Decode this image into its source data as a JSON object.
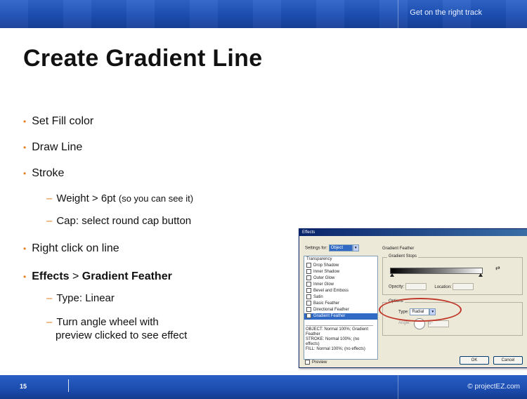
{
  "header": {
    "tagline": "Get on the right track"
  },
  "title": "Create Gradient Line",
  "bullets": [
    {
      "text": "Set Fill color"
    },
    {
      "text": "Draw Line"
    },
    {
      "text": "Stroke"
    },
    {
      "sub_prefix": "Weight > 6pt ",
      "sub_note": "(so you can see it)"
    },
    {
      "text": "Cap:  select round cap button"
    },
    {
      "text": "Right click on line"
    },
    {
      "bold1": "Effects",
      "sep": " > ",
      "bold2": "Gradient Feather"
    },
    {
      "text": "Type:  Linear"
    },
    {
      "text": "Turn angle wheel with"
    },
    {
      "text": "preview clicked to see effect"
    }
  ],
  "footer": {
    "slide_number": "15",
    "copyright": "© projectEZ.com"
  },
  "dialog": {
    "title": "Effects",
    "settings_label": "Settings for:",
    "settings_value": "Object",
    "list_items": [
      "Transparency",
      "Drop Shadow",
      "Inner Shadow",
      "Outer Glow",
      "Inner Glow",
      "Bevel and Emboss",
      "Satin",
      "Basic Feather",
      "Directional Feather",
      "Gradient Feather"
    ],
    "summary": [
      "OBJECT: Normal 100%; Gradient Feather",
      "STROKE: Normal 100%; (no effects)",
      "FILL: Normal 100%; (no effects)"
    ],
    "preview_label": "Preview",
    "panel_title": "Gradient Feather",
    "gradient_stops_label": "Gradient Stops",
    "opacity_label": "Opacity:",
    "location_label": "Location:",
    "options_label": "Options",
    "type_label": "Type:",
    "type_value": "Radial",
    "angle_label": "Angle:",
    "angle_value": "0°",
    "ok_label": "OK",
    "cancel_label": "Cancel"
  }
}
